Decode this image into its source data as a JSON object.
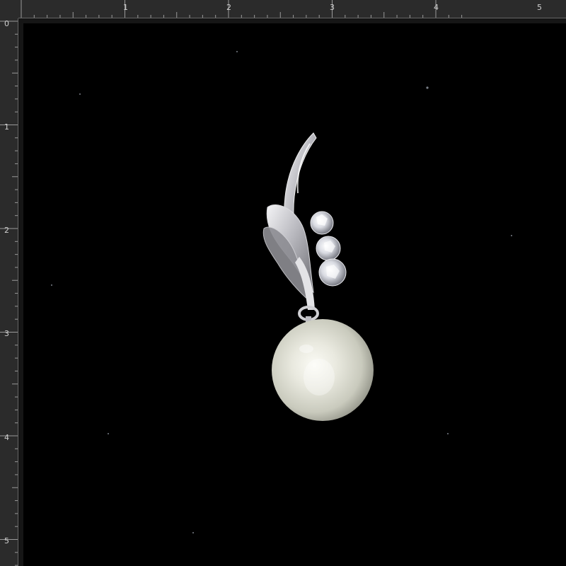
{
  "rulers": {
    "unit": "inches",
    "horizontal_labels": [
      "1",
      "2",
      "3",
      "4",
      "5"
    ],
    "vertical_labels": [
      "0",
      "1",
      "2",
      "3",
      "4",
      "5"
    ]
  },
  "canvas": {
    "background": "#000000",
    "subject": "pearl-pendant-photo"
  },
  "colors": {
    "ruler_bg": "#2b2b2b",
    "ruler_text": "#cfcfcf",
    "pearl": "#e6e6dc",
    "silver": "#d6d6da"
  }
}
